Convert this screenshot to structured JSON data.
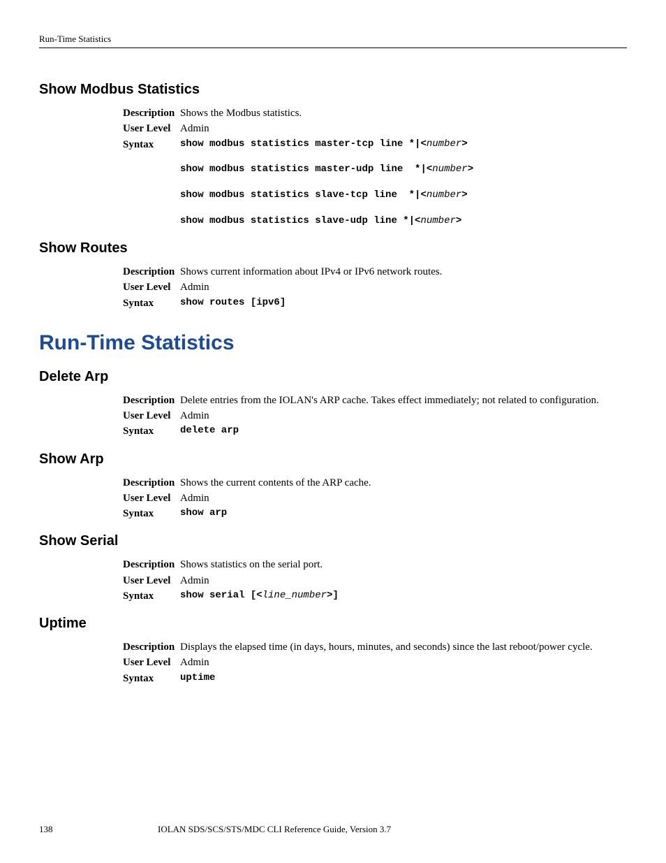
{
  "header": {
    "breadcrumb": "Run-Time Statistics"
  },
  "sections": {
    "modbus": {
      "title": "Show Modbus Statistics",
      "desc_label": "Description",
      "desc": "Shows the Modbus statistics.",
      "ul_label": "User Level",
      "ul": "Admin",
      "sx_label": "Syntax",
      "sx1a": "show modbus statistics master-tcp line *|<",
      "sx1b": "number",
      "sx1c": ">",
      "sx2a": "show modbus statistics master-udp line  *|<",
      "sx2b": "number",
      "sx2c": ">",
      "sx3a": "show modbus statistics slave-tcp line  *|<",
      "sx3b": "number",
      "sx3c": ">",
      "sx4a": "show modbus statistics slave-udp line *|<",
      "sx4b": "number",
      "sx4c": ">"
    },
    "routes": {
      "title": "Show Routes",
      "desc_label": "Description",
      "desc": "Shows current information about IPv4 or IPv6 network routes.",
      "ul_label": "User Level",
      "ul": "Admin",
      "sx_label": "Syntax",
      "sx": "show routes [ipv6]"
    },
    "runtime": {
      "title": "Run-Time Statistics"
    },
    "delarp": {
      "title": "Delete Arp",
      "desc_label": "Description",
      "desc": "Delete entries from the IOLAN's ARP cache. Takes effect immediately; not related to configuration.",
      "ul_label": "User Level",
      "ul": "Admin",
      "sx_label": "Syntax",
      "sx": "delete arp"
    },
    "showarp": {
      "title": "Show Arp",
      "desc_label": "Description",
      "desc": "Shows the current contents of the ARP cache.",
      "ul_label": "User Level",
      "ul": "Admin",
      "sx_label": "Syntax",
      "sx": "show arp"
    },
    "serial": {
      "title": "Show Serial",
      "desc_label": "Description",
      "desc": "Shows statistics on the serial port.",
      "ul_label": "User Level",
      "ul": "Admin",
      "sx_label": "Syntax",
      "sx1a": "show serial [<",
      "sx1b": "line_number",
      "sx1c": ">]"
    },
    "uptime": {
      "title": "Uptime",
      "desc_label": "Description",
      "desc": "Displays the elapsed time (in days, hours, minutes, and seconds) since the last reboot/power cycle.",
      "ul_label": "User Level",
      "ul": "Admin",
      "sx_label": "Syntax",
      "sx": "uptime"
    }
  },
  "footer": {
    "page": "138",
    "text": "IOLAN SDS/SCS/STS/MDC CLI Reference Guide, Version 3.7"
  }
}
